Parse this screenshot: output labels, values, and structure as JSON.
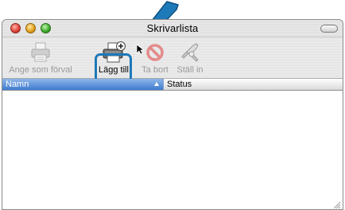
{
  "window": {
    "title": "Skrivarlista",
    "accent_color": "#1e79b8"
  },
  "toolbar": {
    "items": [
      {
        "label": "Ange som förval",
        "icon": "printer-default-icon",
        "enabled": false
      },
      {
        "label": "Lägg till",
        "icon": "add-printer-icon",
        "enabled": true
      },
      {
        "label": "Ta bort",
        "icon": "delete-icon",
        "enabled": false
      },
      {
        "label": "Ställ in",
        "icon": "utility-tools-icon",
        "enabled": false
      }
    ]
  },
  "list": {
    "columns": [
      {
        "label": "Namn",
        "sorted": "ascending"
      },
      {
        "label": "Status"
      }
    ],
    "rows": []
  }
}
